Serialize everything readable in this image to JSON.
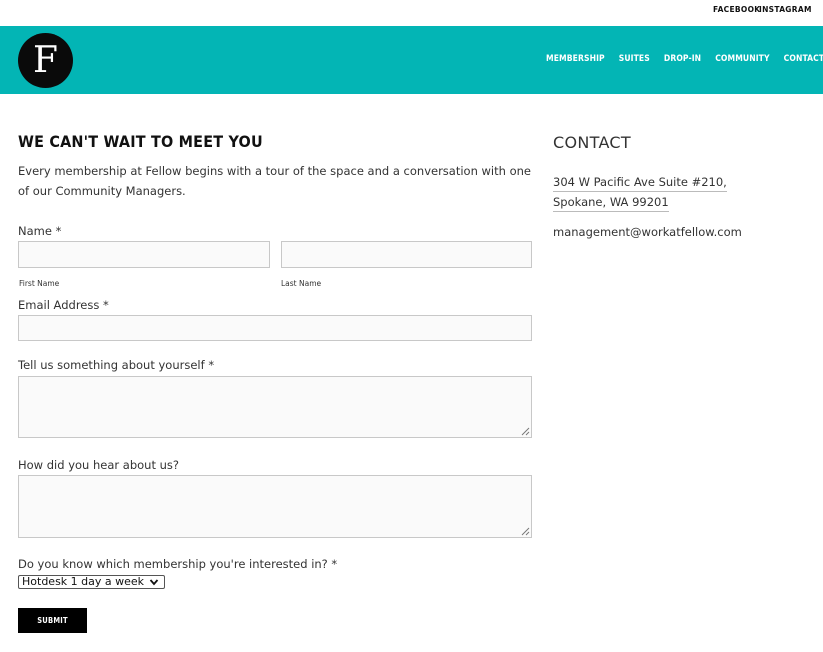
{
  "topbar": {
    "facebook": "FACEBOOK",
    "instagram": "INSTAGRAM"
  },
  "header": {
    "logo_letter": "F",
    "nav": [
      "MEMBERSHIP",
      "SUITES",
      "DROP-IN",
      "COMMUNITY",
      "CONTACT"
    ],
    "bg_color": "#03b5b5"
  },
  "form": {
    "heading": "WE CAN'T WAIT TO MEET YOU",
    "intro": "Every membership at Fellow begins with a tour of the space and a conversation with one of our Community Managers.",
    "name_label": "Name *",
    "first_name_sub": "First Name",
    "last_name_sub": "Last Name",
    "email_label": "Email Address *",
    "about_label": "Tell us something about yourself *",
    "hear_label": "How did you hear about us?",
    "membership_label": "Do you know which membership you're interested in? *",
    "membership_selected": "Hotdesk 1 day a week",
    "submit_label": "SUBMIT"
  },
  "contact": {
    "heading": "CONTACT",
    "address_line1": "304 W Pacific Ave Suite #210,",
    "address_line2": "Spokane, WA 99201",
    "email": "management@workatfellow.com"
  }
}
